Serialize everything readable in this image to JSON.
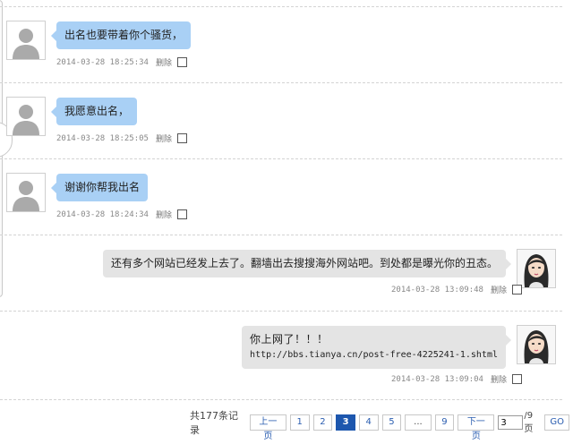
{
  "messages": [
    {
      "direction": "in",
      "text": "出名也要带着你个骚货，",
      "timestamp": "2014-03-28 18:25:34",
      "delete_label": "删除"
    },
    {
      "direction": "in",
      "text": "我愿意出名，",
      "timestamp": "2014-03-28 18:25:05",
      "delete_label": "删除"
    },
    {
      "direction": "in",
      "text": "谢谢你帮我出名",
      "timestamp": "2014-03-28 18:24:34",
      "delete_label": "删除"
    },
    {
      "direction": "out",
      "text": "还有多个网站已经发上去了。翻墙出去搜搜海外网站吧。到处都是曝光你的丑态。",
      "timestamp": "2014-03-28 13:09:48",
      "delete_label": "删除"
    },
    {
      "direction": "out",
      "text": "你上网了！！！",
      "link": "http://bbs.tianya.cn/post-free-4225241-1.shtml",
      "timestamp": "2014-03-28 13:09:04",
      "delete_label": "删除"
    }
  ],
  "pagination": {
    "total_label": "共177条记录",
    "prev_label": "上一页",
    "pages": [
      "1",
      "2",
      "3",
      "4",
      "5"
    ],
    "current_page": "3",
    "ellipsis": "...",
    "last_page": "9",
    "next_label": "下一页",
    "page_input_value": "3",
    "pages_total_label": "/9页",
    "go_label": "GO"
  },
  "colors": {
    "incoming_bubble": "#a9d0f5",
    "outgoing_bubble": "#e4e4e4",
    "current_page": "#1d57ae",
    "link_text": "#2a5db0"
  },
  "icons": {
    "incoming_avatar": "default-user-silhouette-icon",
    "outgoing_avatar": "cartoon-girl-avatar"
  }
}
